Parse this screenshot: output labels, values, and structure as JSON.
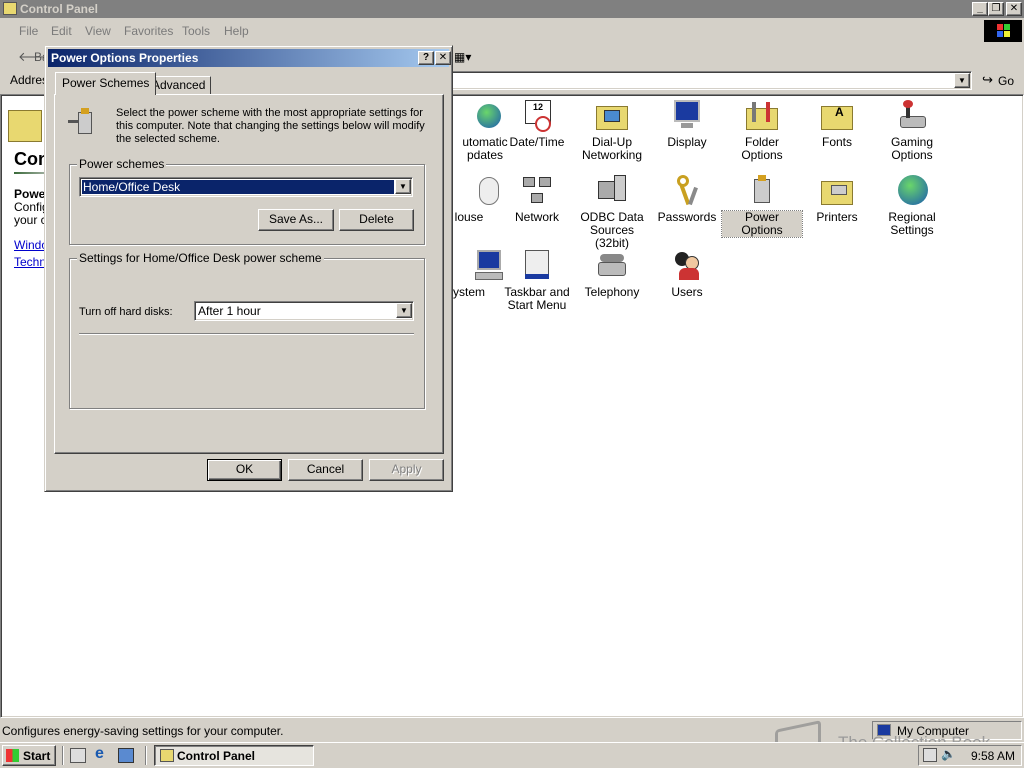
{
  "main_window": {
    "title": "Control Panel",
    "menus": [
      "File",
      "Edit",
      "View",
      "Favorites",
      "Tools",
      "Help"
    ],
    "toolbar_back": "Ba",
    "address_label": "Addres",
    "go_label": "Go"
  },
  "left_pane": {
    "title": "Con",
    "heading": "Powe",
    "desc1": "Config",
    "desc2": "your c",
    "link1": "Windo",
    "link2": "Techni"
  },
  "icons": [
    {
      "label": "Automatic Updates",
      "line1": "utomatic",
      "line2": "pdates",
      "icon": "globe-update-icon"
    },
    {
      "label": "Date/Time",
      "line1": "Date/Time",
      "line2": "",
      "icon": "calendar-clock-icon"
    },
    {
      "label": "Dial-Up Networking",
      "line1": "Dial-Up",
      "line2": "Networking",
      "icon": "dialup-folder-icon"
    },
    {
      "label": "Display",
      "line1": "Display",
      "line2": "",
      "icon": "monitor-icon"
    },
    {
      "label": "Folder Options",
      "line1": "Folder Options",
      "line2": "",
      "icon": "folder-options-icon"
    },
    {
      "label": "Fonts",
      "line1": "Fonts",
      "line2": "",
      "icon": "fonts-folder-icon"
    },
    {
      "label": "Gaming Options",
      "line1": "Gaming",
      "line2": "Options",
      "icon": "joystick-icon"
    },
    {
      "label": "Mouse",
      "line1": "louse",
      "line2": "",
      "icon": "mouse-icon"
    },
    {
      "label": "Network",
      "line1": "Network",
      "line2": "",
      "icon": "network-icon"
    },
    {
      "label": "ODBC Data Sources (32bit)",
      "line1": "ODBC Data",
      "line2": "Sources (32bit)",
      "icon": "odbc-icon"
    },
    {
      "label": "Passwords",
      "line1": "Passwords",
      "line2": "",
      "icon": "keys-icon"
    },
    {
      "label": "Power Options",
      "line1": "Power Options",
      "line2": "",
      "icon": "power-plug-icon"
    },
    {
      "label": "Printers",
      "line1": "Printers",
      "line2": "",
      "icon": "printers-folder-icon"
    },
    {
      "label": "Regional Settings",
      "line1": "Regional",
      "line2": "Settings",
      "icon": "globe-icon"
    },
    {
      "label": "System",
      "line1": "ystem",
      "line2": "",
      "icon": "computer-icon"
    },
    {
      "label": "Taskbar and Start Menu",
      "line1": "Taskbar and",
      "line2": "Start Menu",
      "icon": "taskbar-icon"
    },
    {
      "label": "Telephony",
      "line1": "Telephony",
      "line2": "",
      "icon": "telephone-icon"
    },
    {
      "label": "Users",
      "line1": "Users",
      "line2": "",
      "icon": "users-icon"
    }
  ],
  "dialog": {
    "title": "Power Options Properties",
    "help_btn": "?",
    "close_btn": "✕",
    "tabs": [
      "Power Schemes",
      "Advanced"
    ],
    "desc_line1": "Select the power scheme with the most appropriate settings for",
    "desc_line2": "this computer. Note that changing the settings below will modify",
    "desc_line3": "the selected scheme.",
    "schemes_group": "Power schemes",
    "scheme_value": "Home/Office Desk",
    "save_as": "Save As...",
    "delete": "Delete",
    "settings_group": "Settings for Home/Office Desk power scheme",
    "hard_disk_label": "Turn off hard disks:",
    "hard_disk_value": "After 1 hour",
    "ok": "OK",
    "cancel": "Cancel",
    "apply": "Apply"
  },
  "statusbar": {
    "text": "Configures energy-saving settings for your computer.",
    "zone": "My Computer"
  },
  "taskbar": {
    "start": "Start",
    "task": "Control Panel",
    "clock": "9:58 AM"
  },
  "watermark": "The Collection Book"
}
